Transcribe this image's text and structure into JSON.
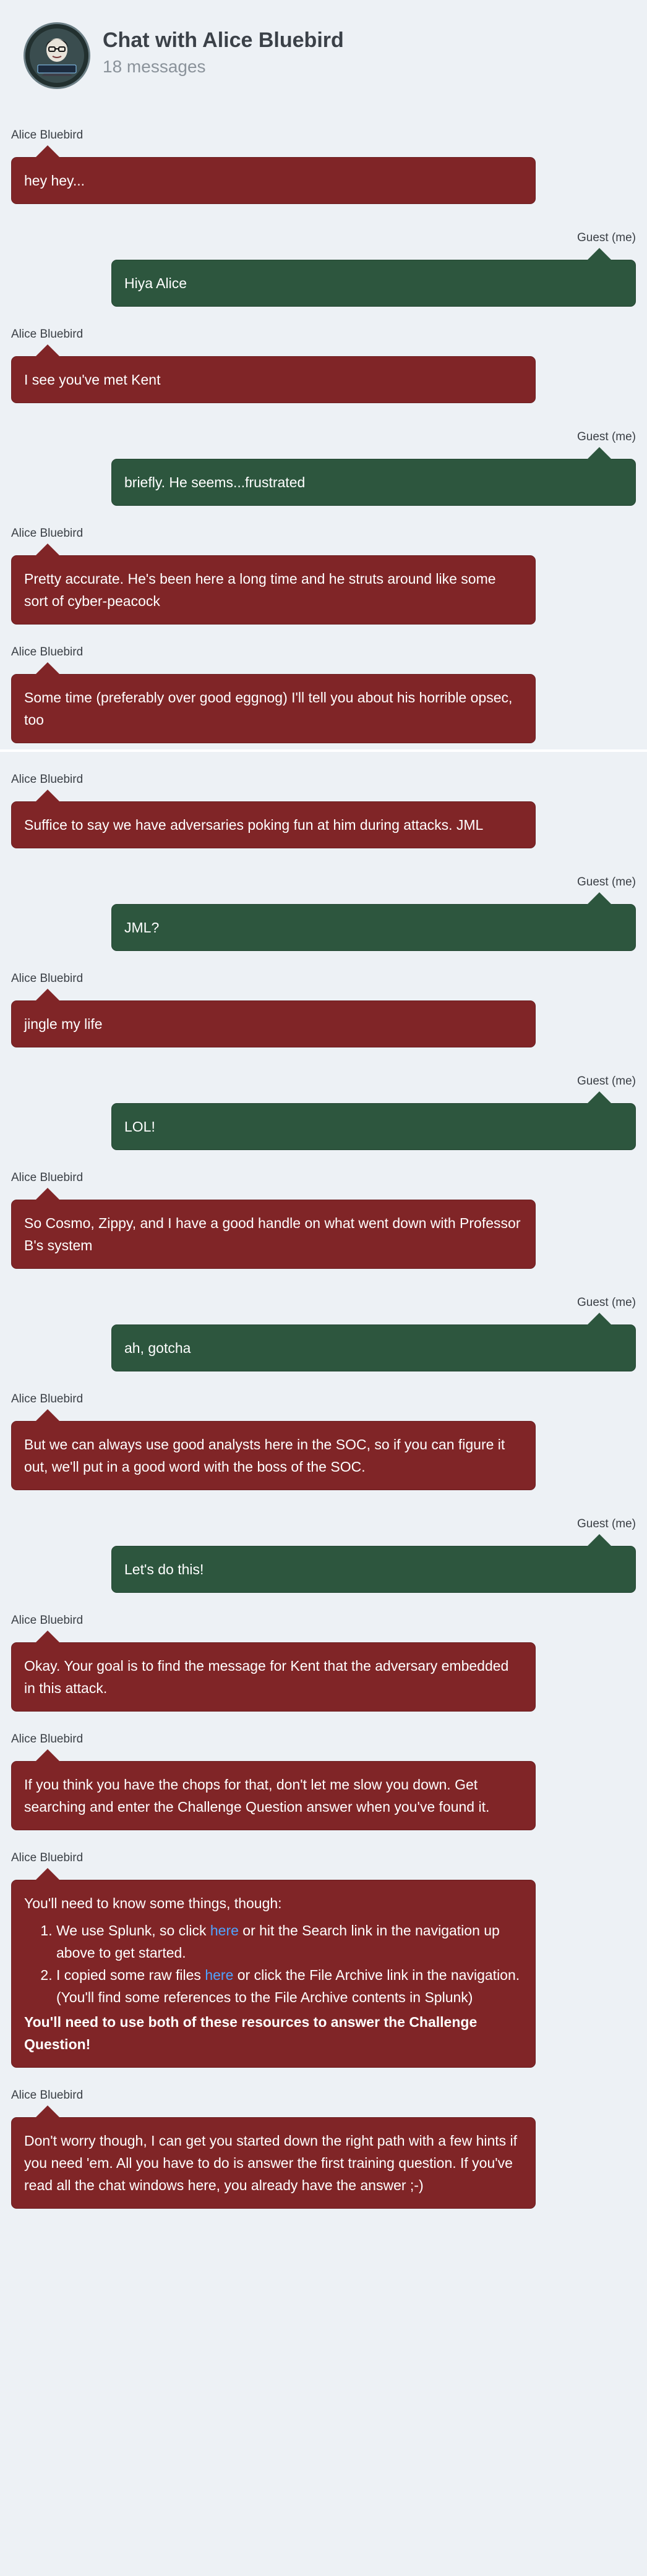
{
  "header": {
    "title": "Chat with Alice Bluebird",
    "message_count": "18 messages",
    "avatar_badge_text": "Alice Bluebird"
  },
  "colors": {
    "background": "#edf1f5",
    "alice_bubble": "#802527",
    "guest_bubble": "#2d563e",
    "link": "#4fa3ff"
  },
  "messages": [
    {
      "sender": "Alice Bluebird",
      "text": "hey hey..."
    },
    {
      "sender": "Guest (me)",
      "text": "Hiya Alice"
    },
    {
      "sender": "Alice Bluebird",
      "text": "I see you've met Kent"
    },
    {
      "sender": "Guest (me)",
      "text": "briefly. He seems...frustrated"
    },
    {
      "sender": "Alice Bluebird",
      "text": "Pretty accurate. He's been here a long time and he struts around like some sort of cyber-peacock"
    },
    {
      "sender": "Alice Bluebird",
      "text": "Some time (preferably over good eggnog) I'll tell you about his horrible opsec, too"
    },
    {
      "sender": "Alice Bluebird",
      "text": "Suffice to say we have adversaries poking fun at him during attacks. JML"
    },
    {
      "sender": "Guest (me)",
      "text": "JML?"
    },
    {
      "sender": "Alice Bluebird",
      "text": "jingle my life"
    },
    {
      "sender": "Guest (me)",
      "text": "LOL!"
    },
    {
      "sender": "Alice Bluebird",
      "text": "So Cosmo, Zippy, and I have a good handle on what went down with Professor B's system"
    },
    {
      "sender": "Guest (me)",
      "text": "ah, gotcha"
    },
    {
      "sender": "Alice Bluebird",
      "text": "But we can always use good analysts here in the SOC, so if you can figure it out, we'll put in a good word with the boss of the SOC."
    },
    {
      "sender": "Guest (me)",
      "text": "Let's do this!"
    },
    {
      "sender": "Alice Bluebird",
      "text": "Okay. Your goal is to find the message for Kent that the adversary embedded in this attack."
    },
    {
      "sender": "Alice Bluebird",
      "text": "If you think you have the chops for that, don't let me slow you down. Get searching and enter the Challenge Question answer when you've found it."
    },
    {
      "sender": "Alice Bluebird",
      "intro": "You'll need to know some things, though:",
      "item1_before": "We use Splunk, so click ",
      "item1_link": "here",
      "item1_after": " or hit the Search link in the navigation up above to get started.",
      "item2_before": "I copied some raw files ",
      "item2_link": "here",
      "item2_after": " or click the File Archive link in the navigation. (You'll find some references to the File Archive contents in Splunk)",
      "footer_bold": "You'll need to use both of these resources to answer the Challenge Question!"
    },
    {
      "sender": "Alice Bluebird",
      "text": "Don't worry though, I can get you started down the right path with a few hints if you need 'em. All you have to do is answer the first training question. If you've read all the chat windows here, you already have the answer ;-)"
    }
  ]
}
